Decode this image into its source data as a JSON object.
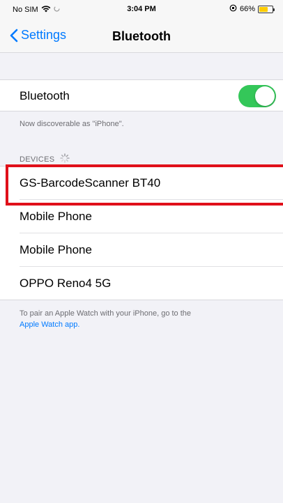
{
  "status_bar": {
    "carrier": "No SIM",
    "time": "3:04 PM",
    "battery": "66%",
    "battery_level": 0.66
  },
  "nav": {
    "back_label": "Settings",
    "title": "Bluetooth"
  },
  "bluetooth_toggle": {
    "label": "Bluetooth",
    "enabled": true,
    "accent": "#34c759"
  },
  "discoverable_text": "Now discoverable as \"iPhone\".",
  "devices_header": "DEVICES",
  "devices": [
    {
      "label": "GS-BarcodeScanner BT40",
      "highlighted": true
    },
    {
      "label": "Mobile Phone",
      "highlighted": false
    },
    {
      "label": "Mobile Phone",
      "highlighted": false
    },
    {
      "label": "OPPO Reno4 5G",
      "highlighted": false
    }
  ],
  "pair_note": {
    "text": "To pair an Apple Watch with your iPhone, go to the",
    "link": "Apple Watch app."
  },
  "colors": {
    "link": "#007aff",
    "highlight": "#e0101a",
    "background": "#f2f2f7"
  }
}
